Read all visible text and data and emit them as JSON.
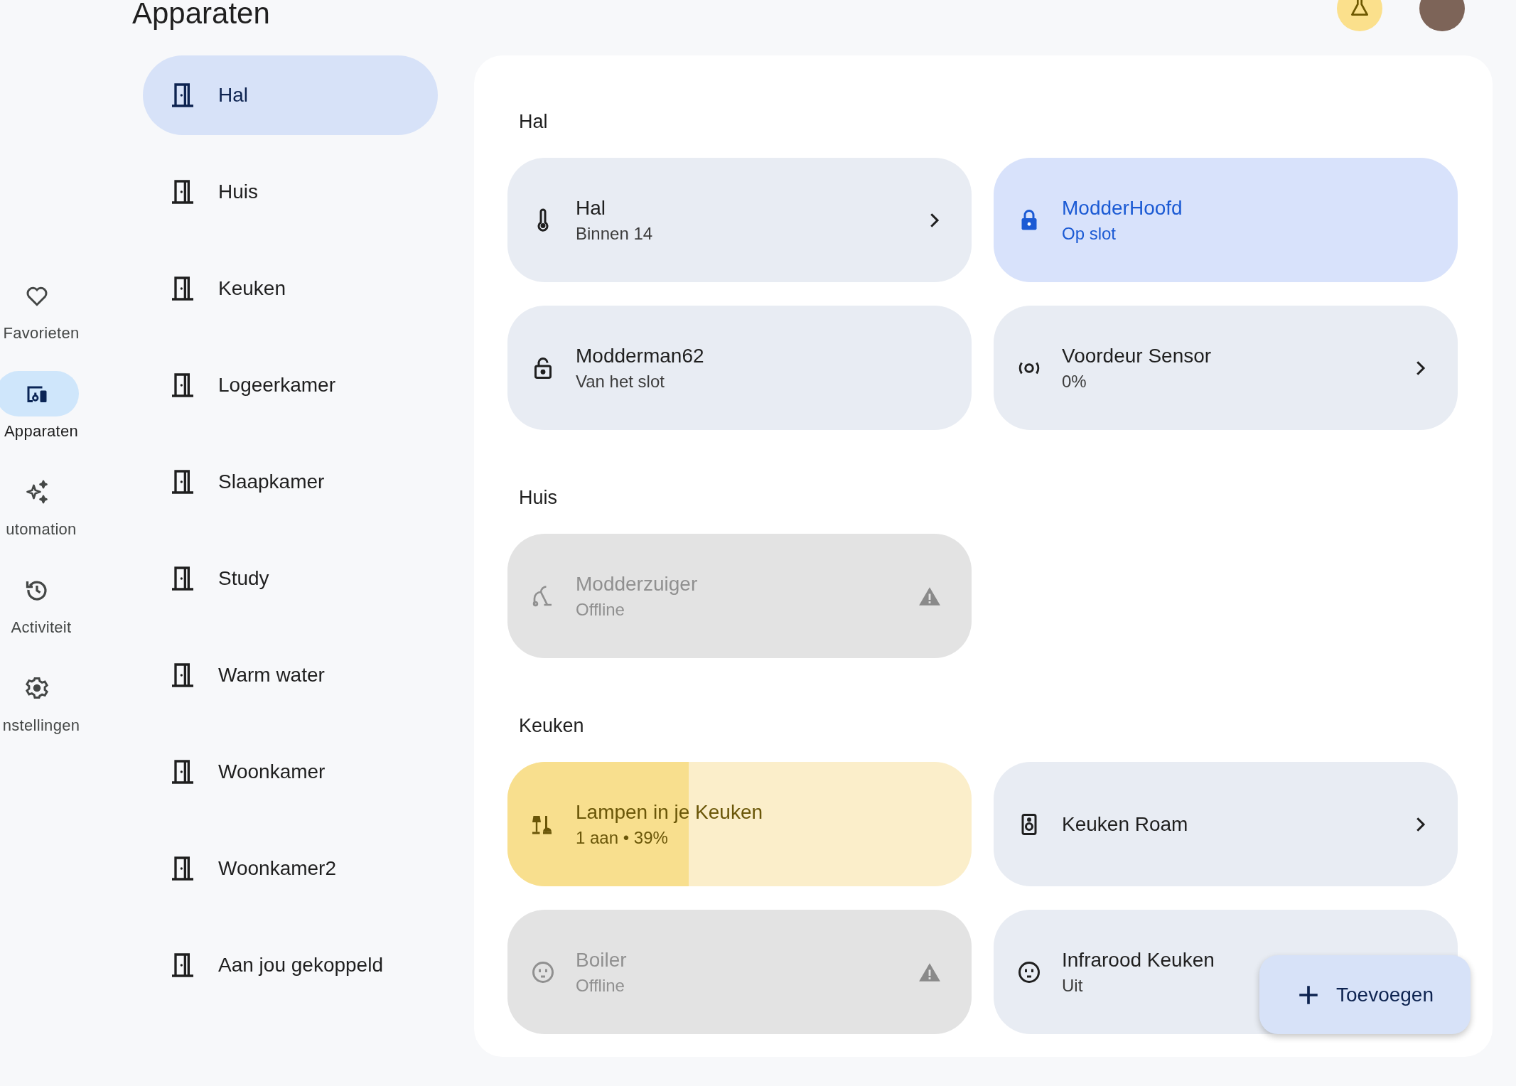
{
  "header": {
    "title": "Apparaten"
  },
  "nav_rail": [
    {
      "kind": "heart",
      "label": "Favorieten",
      "selected": false
    },
    {
      "kind": "devices",
      "label": "Apparaten",
      "selected": true
    },
    {
      "kind": "sparkle",
      "label": "utomation",
      "selected": false
    },
    {
      "kind": "history",
      "label": "Activiteit",
      "selected": false
    },
    {
      "kind": "gear",
      "label": "nstellingen",
      "selected": false
    }
  ],
  "rooms": [
    {
      "label": "Hal",
      "selected": true
    },
    {
      "label": "Huis",
      "selected": false
    },
    {
      "label": "Keuken",
      "selected": false
    },
    {
      "label": "Logeerkamer",
      "selected": false
    },
    {
      "label": "Slaapkamer",
      "selected": false
    },
    {
      "label": "Study",
      "selected": false
    },
    {
      "label": "Warm water",
      "selected": false
    },
    {
      "label": "Woonkamer",
      "selected": false
    },
    {
      "label": "Woonkamer2",
      "selected": false
    },
    {
      "label": "Aan jou gekoppeld",
      "selected": false
    }
  ],
  "sections": [
    {
      "title": "Hal",
      "devices": [
        {
          "kind": "thermometer",
          "name": "Hal",
          "status": "Binnen 14",
          "active": false,
          "offline": false,
          "chevron": true
        },
        {
          "kind": "lock",
          "name": "ModderHoofd",
          "status": "Op slot",
          "active": true,
          "offline": false,
          "chevron": false
        },
        {
          "kind": "unlock",
          "name": "Modderman62",
          "status": "Van het slot",
          "active": false,
          "offline": false,
          "chevron": false
        },
        {
          "kind": "sensor",
          "name": "Voordeur Sensor",
          "status": "0%",
          "active": false,
          "offline": false,
          "chevron": true
        }
      ]
    },
    {
      "title": "Huis",
      "devices": [
        {
          "kind": "vacuum",
          "name": "Modderzuiger",
          "status": "Offline",
          "offline": true,
          "chevron": false
        }
      ]
    },
    {
      "title": "Keuken",
      "devices": [
        {
          "kind": "lamp",
          "name": "Lampen in je Keuken",
          "status": "1 aan • 39%",
          "active": true,
          "offline": false,
          "level": 0.39,
          "chevron": false
        },
        {
          "kind": "speaker",
          "name": "Keuken Roam",
          "active": false,
          "offline": false,
          "chevron": true
        },
        {
          "kind": "outlet",
          "name": "Boiler",
          "status": "Offline",
          "offline": true,
          "chevron": false
        },
        {
          "kind": "outlet",
          "name": "Infrarood Keuken",
          "status": "Uit",
          "active": false,
          "offline": false,
          "chevron": false
        }
      ]
    }
  ],
  "fab": {
    "label": "Toevoegen"
  }
}
